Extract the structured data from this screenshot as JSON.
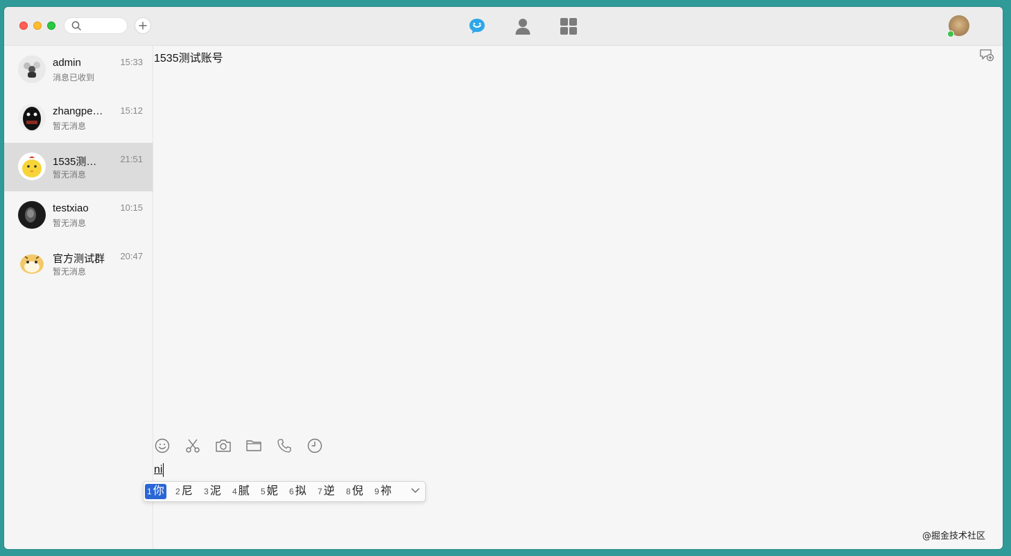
{
  "colors": {
    "accent": "#2ea7e8",
    "selected_candidate": "#2a66d6",
    "online": "#3ec24a",
    "desktop_background": "#2f9a98"
  },
  "titlebar": {
    "icons": [
      "search-icon",
      "plus-icon",
      "chat-icon",
      "contacts-icon",
      "apps-icon"
    ]
  },
  "conversations": [
    {
      "name": "admin",
      "time": "15:33",
      "preview": "消息已收到"
    },
    {
      "name": "zhangpe…",
      "time": "15:12",
      "preview": "暂无消息"
    },
    {
      "name": "1535测…",
      "time": "21:51",
      "preview": "暂无消息"
    },
    {
      "name": "testxiao",
      "time": "10:15",
      "preview": "暂无消息"
    },
    {
      "name": "官方测试群",
      "time": "20:47",
      "preview": "暂无消息"
    }
  ],
  "chat": {
    "title": "1535测试账号",
    "input_value": "ni"
  },
  "toolbar": {
    "icons": [
      "emoji-icon",
      "scissors-icon",
      "camera-icon",
      "folder-icon",
      "phone-icon",
      "clock-icon"
    ]
  },
  "ime": {
    "candidates": [
      {
        "num": "1",
        "text": "你"
      },
      {
        "num": "2",
        "text": "尼"
      },
      {
        "num": "3",
        "text": "泥"
      },
      {
        "num": "4",
        "text": "腻"
      },
      {
        "num": "5",
        "text": "妮"
      },
      {
        "num": "6",
        "text": "拟"
      },
      {
        "num": "7",
        "text": "逆"
      },
      {
        "num": "8",
        "text": "倪"
      },
      {
        "num": "9",
        "text": "祢"
      }
    ]
  },
  "watermark": "@掘金技术社区"
}
